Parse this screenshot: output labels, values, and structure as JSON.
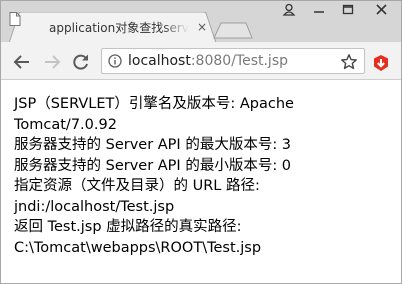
{
  "browser": {
    "tab": {
      "title": "application对象查找serv",
      "close_glyph": "×"
    },
    "address": {
      "host": "localhost",
      "rest": ":8080/Test.jsp"
    },
    "colors": {
      "titlebar": "#d6d6d6",
      "toolbar": "#f2f2f2",
      "extension": "#e52e1f"
    },
    "icons": {
      "profile": "user-icon",
      "minimize": "minimize-icon",
      "maximize": "maximize-icon",
      "close": "close-icon",
      "back": "back-arrow-icon",
      "forward": "forward-arrow-icon",
      "reload": "reload-icon",
      "info": "info-icon",
      "bookmark": "star-icon",
      "extension": "extension-icon",
      "page": "page-icon"
    }
  },
  "page": {
    "lines": [
      "JSP（SERVLET）引擎名及版本号: Apache",
      "Tomcat/7.0.92",
      "服务器支持的 Server API 的最大版本号: 3",
      "服务器支持的 Server API 的最小版本号: 0",
      "指定资源（文件及目录）的 URL 路径:",
      "jndi:/localhost/Test.jsp",
      "返回 Test.jsp 虚拟路径的真实路径:",
      "C:\\Tomcat\\webapps\\ROOT\\Test.jsp"
    ]
  }
}
